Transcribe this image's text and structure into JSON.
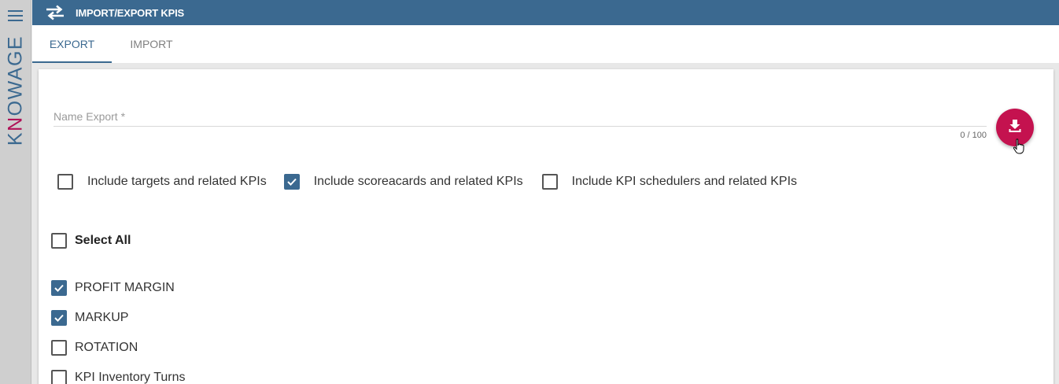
{
  "app": {
    "logo_pre": "K",
    "logo_accent": "N",
    "logo_post": "OWAGE",
    "header_title": "IMPORT/EXPORT KPIS"
  },
  "tabs": [
    {
      "label": "EXPORT",
      "active": true
    },
    {
      "label": "IMPORT",
      "active": false
    }
  ],
  "export": {
    "name_placeholder": "Name Export *",
    "name_value": "",
    "counter": "0 / 100",
    "download_button_icon": "download-icon"
  },
  "options": [
    {
      "label": "Include targets and related KPIs",
      "checked": false
    },
    {
      "label": "Include scoreacards and related KPIs",
      "checked": true
    },
    {
      "label": "Include KPI schedulers and related KPIs",
      "checked": false
    }
  ],
  "select_all": {
    "label": "Select All",
    "checked": false
  },
  "kpis": [
    {
      "label": "PROFIT MARGIN",
      "checked": true
    },
    {
      "label": "MARKUP",
      "checked": true
    },
    {
      "label": "ROTATION",
      "checked": false
    },
    {
      "label": "KPI Inventory Turns",
      "checked": false
    }
  ],
  "colors": {
    "primary": "#3b6990",
    "accent": "#c4124f"
  }
}
